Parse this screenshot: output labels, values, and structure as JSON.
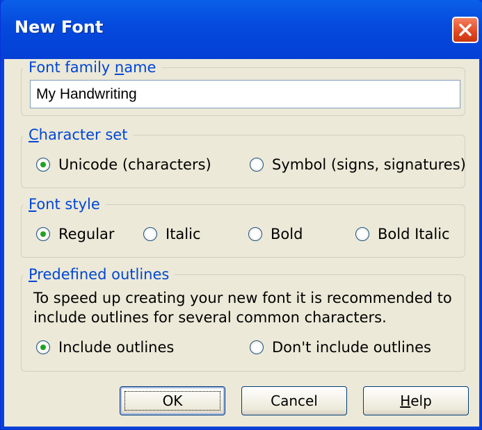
{
  "window": {
    "title": "New Font"
  },
  "family": {
    "legend_prefix": "Font family ",
    "legend_underlined": "n",
    "legend_suffix": "ame",
    "value": "My Handwriting"
  },
  "charset": {
    "legend_underlined": "C",
    "legend_suffix": "haracter set",
    "options": [
      {
        "label": "Unicode (characters)",
        "selected": true
      },
      {
        "label": "Symbol (signs, signatures)",
        "selected": false
      }
    ]
  },
  "style": {
    "legend_underlined": "F",
    "legend_suffix": "ont style",
    "options": [
      {
        "label": "Regular",
        "selected": true
      },
      {
        "label": "Italic",
        "selected": false
      },
      {
        "label": "Bold",
        "selected": false
      },
      {
        "label": "Bold Italic",
        "selected": false
      }
    ]
  },
  "outlines": {
    "legend_underlined": "P",
    "legend_suffix": "redefined outlines",
    "desc_line1": "To speed up creating your new font it is recommended to",
    "desc_line2": "include outlines for several common characters.",
    "options": [
      {
        "label": "Include outlines",
        "selected": true
      },
      {
        "label": "Don't include outlines",
        "selected": false
      }
    ]
  },
  "buttons": {
    "ok": "OK",
    "cancel": "Cancel",
    "help_underlined": "H",
    "help_suffix": "elp"
  },
  "colors": {
    "titlebar": "#0549dc",
    "legend": "#0046d5",
    "radio_dot": "#21a121",
    "close": "#e04820"
  }
}
